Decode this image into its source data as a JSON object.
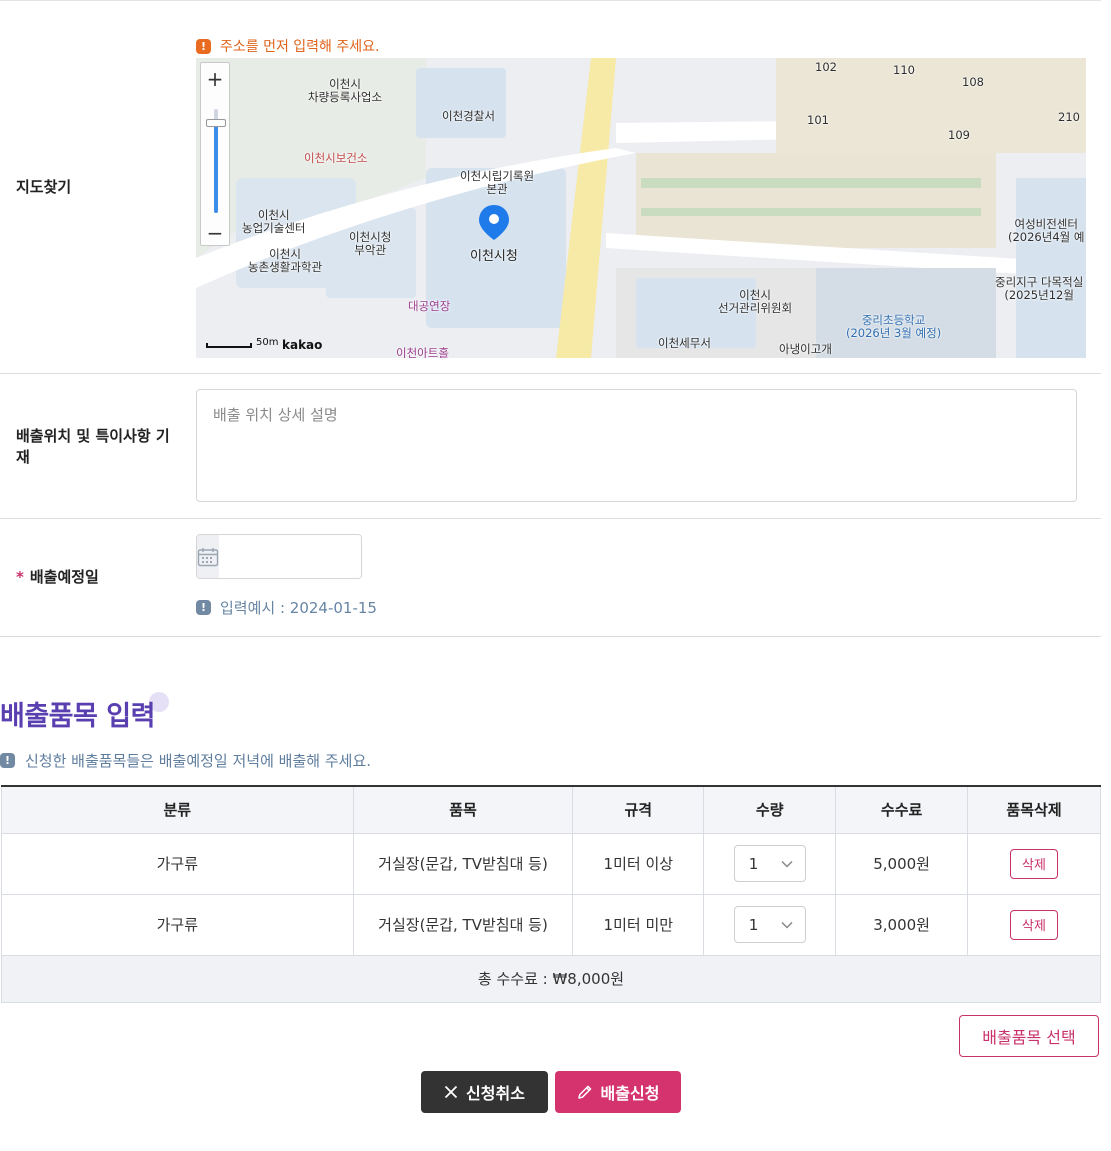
{
  "map_row": {
    "label": "지도찾기",
    "warning": "주소를 먼저 입력해 주세요.",
    "map": {
      "scale": "50m",
      "brand": "kakao",
      "zoom_in": "+",
      "zoom_out": "−",
      "labels": {
        "car_registration": "이천시\n차량등록사업소",
        "police": "이천경찰서",
        "health_center": "이천시보건소",
        "archive": "이천시립기록원\n본관",
        "agri_center": "이천시\n농업기술센터",
        "city_annex": "이천시청\n부악관",
        "rural_science": "이천시\n농촌생활과학관",
        "city_hall": "이천시청",
        "plaza": "대공연장",
        "election": "이천시\n선거관리위원회",
        "tax_office": "이천세무서",
        "ayangi": "아냉이고개",
        "school": "중리초등학교\n(2026년 3월 예정)",
        "women_center": "여성비전센터\n(2026년4월 예",
        "multi_hall": "중리지구 다목적실\n(2025년12월",
        "art_hall": "이천아트홀",
        "apt_102": "102",
        "apt_110": "110",
        "apt_108": "108",
        "apt_101": "101",
        "apt_109": "109",
        "apt_210": "210"
      }
    }
  },
  "note_row": {
    "label": "배출위치 및 특이사항 기재",
    "placeholder": "배출 위치 상세 설명"
  },
  "date_row": {
    "required_mark": "*",
    "label": "배출예정일",
    "value": "",
    "hint": "입력예시 : 2024-01-15"
  },
  "items_section": {
    "title": "배출품목 입력",
    "hint": "신청한 배출품목들은 배출예정일 저녁에 배출해 주세요.",
    "columns": [
      "분류",
      "품목",
      "규격",
      "수량",
      "수수료",
      "품목삭제"
    ],
    "rows": [
      {
        "category": "가구류",
        "item": "거실장(문갑, TV받침대 등)",
        "spec": "1미터 이상",
        "qty": "1",
        "fee": "5,000원",
        "delete": "삭제"
      },
      {
        "category": "가구류",
        "item": "거실장(문갑, TV받침대 등)",
        "spec": "1미터 미만",
        "qty": "1",
        "fee": "3,000원",
        "delete": "삭제"
      }
    ],
    "total": "총 수수료 : ₩8,000원",
    "select_button": "배출품목 선택"
  },
  "actions": {
    "cancel": "신청취소",
    "submit": "배출신청"
  },
  "colors": {
    "accent": "#c8316a",
    "title": "#5a3fb0",
    "warning": "#e0641c"
  }
}
